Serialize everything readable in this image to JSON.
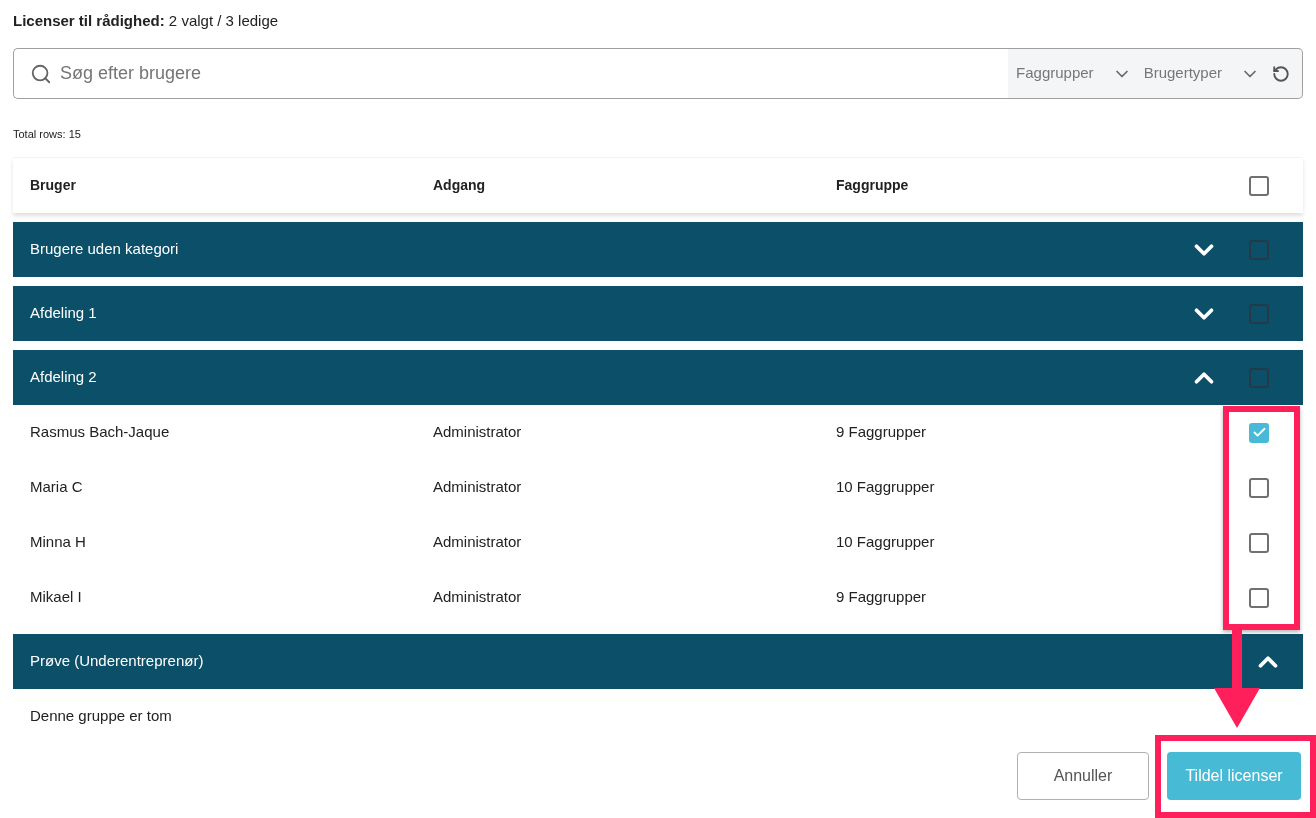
{
  "summary": {
    "label": "Licenser til rådighed:",
    "value": "2 valgt / 3 ledige"
  },
  "search": {
    "placeholder": "Søg efter brugere"
  },
  "filters": [
    {
      "label": "Faggrupper"
    },
    {
      "label": "Brugertyper"
    }
  ],
  "total_rows": "Total rows: 15",
  "table": {
    "columns": [
      "Bruger",
      "Adgang",
      "Faggruppe"
    ],
    "select_all": {
      "checked": false
    },
    "groups": [
      {
        "name": "Brugere uden kategori",
        "kind": "selectable",
        "checked": false,
        "expanded": false
      },
      {
        "name": "Afdeling 1",
        "kind": "selectable",
        "checked": false,
        "expanded": false
      },
      {
        "name": "Afdeling 2",
        "kind": "selectable",
        "checked": false,
        "expanded": true,
        "rows": [
          {
            "user": "Rasmus Bach-Jaque",
            "access": "Administrator",
            "group": "9 Faggrupper",
            "checked": true
          },
          {
            "user": "Maria C",
            "access": "Administrator",
            "group": "10 Faggrupper",
            "checked": false
          },
          {
            "user": "Minna H",
            "access": "Administrator",
            "group": "10 Faggrupper",
            "checked": false
          },
          {
            "user": "Mikael I",
            "access": "Administrator",
            "group": "9 Faggrupper",
            "checked": false
          }
        ]
      },
      {
        "name": "Prøve (Underentreprenør)",
        "kind": "plain",
        "expanded": true,
        "empty_text": "Denne gruppe er tom"
      }
    ]
  },
  "buttons": [
    {
      "label": "Annuller",
      "kind": "secondary"
    },
    {
      "label": "Tildel licenser",
      "kind": "primary"
    }
  ]
}
